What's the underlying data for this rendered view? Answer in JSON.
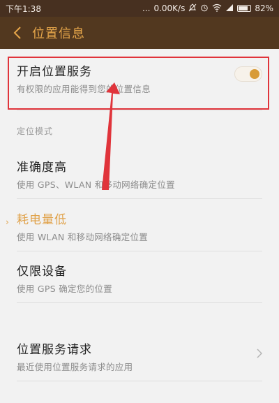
{
  "status_bar": {
    "time": "下午1:38",
    "dots": "...",
    "speed": "0.00K/s",
    "battery": "82%",
    "battery_level": 0.82,
    "icons": [
      "mute-icon",
      "alarm-icon",
      "wifi-icon",
      "signal-icon",
      "battery-icon"
    ]
  },
  "title_bar": {
    "title": "位置信息",
    "back_icon": "chevron-left-icon"
  },
  "location_service": {
    "title": "开启位置服务",
    "subtitle": "有权限的应用能得到您的位置信息",
    "toggle_on": true
  },
  "mode_section": {
    "label": "定位模式",
    "options": [
      {
        "title": "准确度高",
        "subtitle": "使用 GPS、WLAN 和移动网络确定位置",
        "selected": false
      },
      {
        "title": "耗电量低",
        "subtitle": "使用 WLAN 和移动网络确定位置",
        "selected": true
      },
      {
        "title": "仅限设备",
        "subtitle": "使用 GPS 确定您的位置",
        "selected": false
      }
    ],
    "selected_marker": "›"
  },
  "requests": {
    "title": "位置服务请求",
    "subtitle": "最近使用位置服务请求的应用"
  },
  "colors": {
    "status_bar": "#473020",
    "title_bar": "#52381f",
    "accent": "#e0a24a",
    "annotation": "#e0343b"
  }
}
